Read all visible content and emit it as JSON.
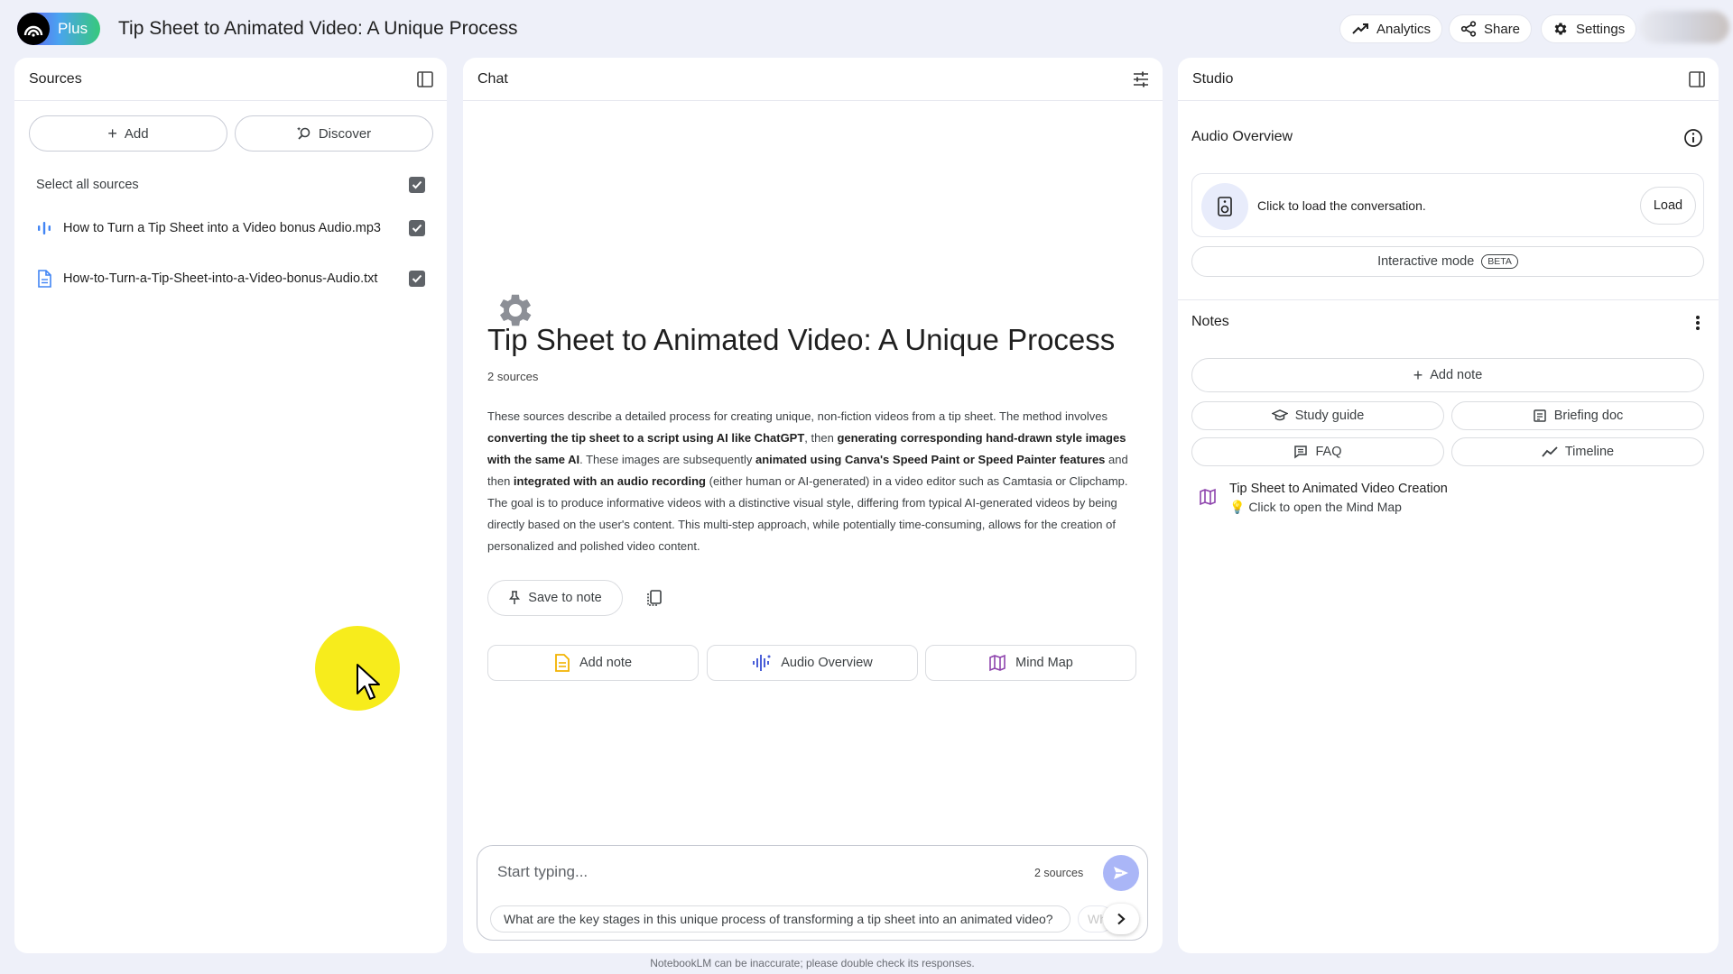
{
  "header": {
    "plan_label": "Plus",
    "title": "Tip Sheet to Animated Video: A Unique Process",
    "analytics_label": "Analytics",
    "share_label": "Share",
    "settings_label": "Settings"
  },
  "sources": {
    "title": "Sources",
    "add_label": "Add",
    "discover_label": "Discover",
    "select_all_label": "Select all sources",
    "select_all_checked": true,
    "items": [
      {
        "name": "How to Turn a Tip Sheet into a Video bonus Audio.mp3",
        "type_icon": "audio-icon",
        "checked": true
      },
      {
        "name": "How-to-Turn-a-Tip-Sheet-into-a-Video-bonus-Audio.txt",
        "type_icon": "document-icon",
        "checked": true
      }
    ]
  },
  "chat": {
    "title": "Chat",
    "notebook_title": "Tip Sheet to Animated Video: A Unique Process",
    "source_count": "2 sources",
    "summary_parts": [
      {
        "text": "These sources describe a detailed process for creating unique, non-fiction videos from a tip sheet. The method involves ",
        "bold": false
      },
      {
        "text": "converting the tip sheet to a script using AI like ChatGPT",
        "bold": true
      },
      {
        "text": ", then ",
        "bold": false
      },
      {
        "text": "generating corresponding hand-drawn style images with the same AI",
        "bold": true
      },
      {
        "text": ". These images are subsequently ",
        "bold": false
      },
      {
        "text": "animated using Canva's Speed Paint or Speed Painter features",
        "bold": true
      },
      {
        "text": " and then ",
        "bold": false
      },
      {
        "text": "integrated with an audio recording",
        "bold": true
      },
      {
        "text": " (either human or AI-generated) in a video editor such as Camtasia or Clipchamp. The goal is to produce informative videos with a distinctive visual style, differing from typical AI-generated videos by being directly based on the user's content. This multi-step approach, while potentially time-consuming, allows for the creation of personalized and polished video content.",
        "bold": false
      }
    ],
    "save_to_note_label": "Save to note",
    "actions": [
      {
        "label": "Add note",
        "icon": "note-icon"
      },
      {
        "label": "Audio Overview",
        "icon": "audio-wave-icon"
      },
      {
        "label": "Mind Map",
        "icon": "map-icon"
      }
    ],
    "input_placeholder": "Start typing...",
    "input_source_count": "2 sources",
    "suggestion": "What are the key stages in this unique process of transforming a tip sheet into an animated video?",
    "suggestion_next_partial": "Wh",
    "disclaimer": "NotebookLM can be inaccurate; please double check its responses."
  },
  "studio": {
    "title": "Studio",
    "audio_overview_title": "Audio Overview",
    "audio_prompt": "Click to load the conversation.",
    "load_label": "Load",
    "interactive_label": "Interactive mode",
    "beta_label": "BETA",
    "notes_title": "Notes",
    "add_note_label": "Add note",
    "note_buttons": [
      {
        "label": "Study guide",
        "icon": "graduation-cap-icon"
      },
      {
        "label": "Briefing doc",
        "icon": "briefing-icon"
      },
      {
        "label": "FAQ",
        "icon": "faq-icon"
      },
      {
        "label": "Timeline",
        "icon": "timeline-icon"
      }
    ],
    "mind_map_note_title": "Tip Sheet to Animated Video Creation",
    "mind_map_note_sub": "💡 Click to open the Mind Map"
  },
  "colors": {
    "background": "#eef0f9",
    "accent": "#aab6f7",
    "cursor_highlight": "#f7ec1c"
  }
}
